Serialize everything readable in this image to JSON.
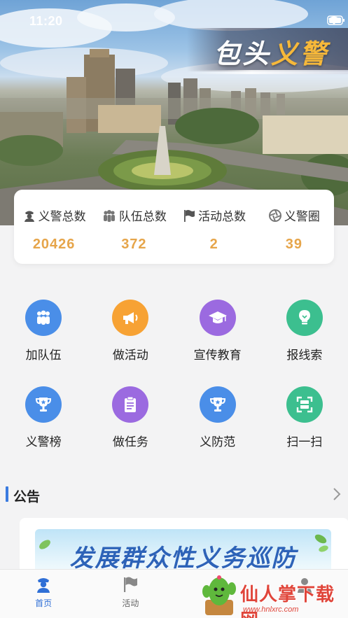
{
  "status_bar": {
    "time": "11:20"
  },
  "hero": {
    "title_main": "包头",
    "title_accent": "义警"
  },
  "stats": [
    {
      "label": "义警总数",
      "value": "20426",
      "icon": "police-icon"
    },
    {
      "label": "队伍总数",
      "value": "372",
      "icon": "team-icon"
    },
    {
      "label": "活动总数",
      "value": "2",
      "icon": "flag-icon"
    },
    {
      "label": "义警圈",
      "value": "39",
      "icon": "aperture-icon"
    }
  ],
  "grid": [
    {
      "label": "加队伍",
      "icon": "team-icon",
      "color": "#4a8ee8"
    },
    {
      "label": "做活动",
      "icon": "megaphone-icon",
      "color": "#f7a234"
    },
    {
      "label": "宣传教育",
      "icon": "graduation-cap-icon",
      "color": "#9b6ae0"
    },
    {
      "label": "报线索",
      "icon": "lightbulb-icon",
      "color": "#3cbf8f"
    },
    {
      "label": "义警榜",
      "icon": "trophy-icon",
      "color": "#4a8ee8"
    },
    {
      "label": "做任务",
      "icon": "clipboard-icon",
      "color": "#9b6ae0"
    },
    {
      "label": "义防范",
      "icon": "trophy-icon",
      "color": "#4a8ee8"
    },
    {
      "label": "扫一扫",
      "icon": "scan-icon",
      "color": "#3cbf8f"
    }
  ],
  "notice": {
    "title": "公告",
    "banner_text": "发展群众性义务巡防"
  },
  "tabbar": {
    "tabs": [
      {
        "label": "首页",
        "icon": "police-officer-icon",
        "active": true
      },
      {
        "label": "活动",
        "icon": "flag-icon",
        "active": false
      },
      {
        "label": "",
        "icon": "download-icon",
        "active": false
      },
      {
        "label": "",
        "icon": "user-icon",
        "active": false
      }
    ]
  },
  "watermark": {
    "text": "仙人掌下载网",
    "sub": "www.hnlxrc.com"
  },
  "colors": {
    "accent": "#2f6fd6",
    "stat_value": "#e6a54a",
    "title_accent": "#f6b83a"
  }
}
